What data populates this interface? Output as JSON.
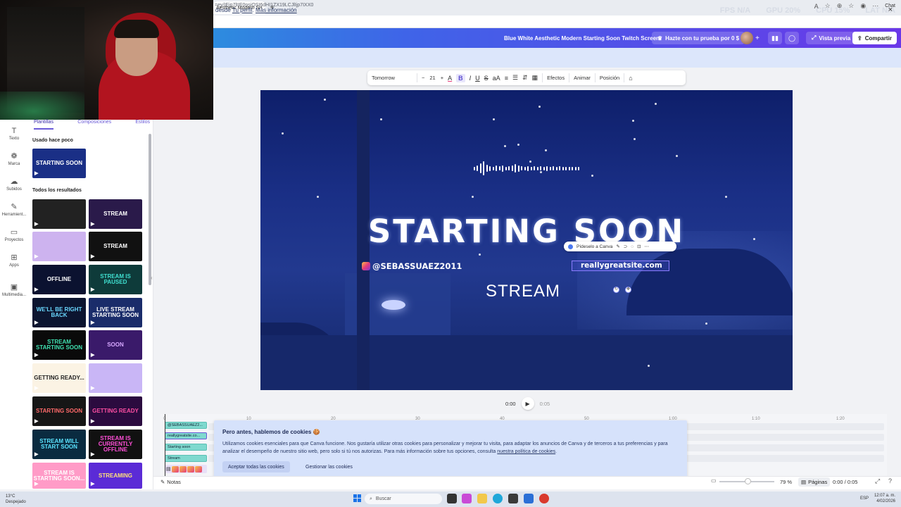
{
  "browser": {
    "tab_title": "Aesthetic Modern Star",
    "tab_close": "×",
    "new_tab": "+",
    "stats": [
      "FPS N/A",
      "GPU 20%",
      "CPU 15%",
      "LAT N/A"
    ],
    "url": "=ey/IEjp7lIIE0nsiQSI6dHI1ZX19LCJlIjp7IXX0",
    "chat_label": "Chat"
  },
  "header": {
    "doc_title": "Blue White Aesthetic Modern Starting Soon Twitch Screen",
    "trial_label": "Hazte con tu prueba por 0 $",
    "preview_label": "Vista previa",
    "share_label": "Compartir"
  },
  "banner": {
    "prefix": "desde",
    "profile_link": "Tu perfil",
    "more_link": "Más información",
    "close": "×"
  },
  "rail": [
    {
      "label": "Texto",
      "icon": "T"
    },
    {
      "label": "Marca",
      "icon": "❁"
    },
    {
      "label": "Subidos",
      "icon": "☁"
    },
    {
      "label": "Herramient...",
      "icon": "✎"
    },
    {
      "label": "Proyectos",
      "icon": "▭"
    },
    {
      "label": "Apps",
      "icon": "⊞"
    },
    {
      "label": "Multimedia...",
      "icon": "▣"
    }
  ],
  "panel": {
    "tabs": [
      "Plantillas",
      "Composiciones",
      "Estilos"
    ],
    "recent_label": "Usado hace poco",
    "all_label": "Todos los resultados",
    "recent_thumb": "STARTING SOON",
    "thumbs": [
      {
        "text": "",
        "bg": "#222",
        "fg": "#fff"
      },
      {
        "text": "STREAM",
        "bg": "#2a1a4a",
        "fg": "#fff"
      },
      {
        "text": "",
        "bg": "#cdb3ef",
        "fg": "#fff"
      },
      {
        "text": "STREAM",
        "bg": "#111",
        "fg": "#fff"
      },
      {
        "text": "OFFLINE",
        "bg": "#0b1230",
        "fg": "#fff"
      },
      {
        "text": "STREAM IS PAUSED",
        "bg": "#0e3b3a",
        "fg": "#3fe0d0"
      },
      {
        "text": "WE'LL BE RIGHT BACK",
        "bg": "#0c1530",
        "fg": "#6ad8ff"
      },
      {
        "text": "LIVE STREAM STARTING SOON",
        "bg": "#1a2c6a",
        "fg": "#fff"
      },
      {
        "text": "STREAM STARTING SOON",
        "bg": "#0a0a0a",
        "fg": "#3fe0b0"
      },
      {
        "text": "SOON",
        "bg": "#3a1a6a",
        "fg": "#d7a8ff"
      },
      {
        "text": "GETTING READY...",
        "bg": "#fbf3e4",
        "fg": "#222"
      },
      {
        "text": "",
        "bg": "#c9b6f6",
        "fg": "#fff"
      },
      {
        "text": "STARTING SOON",
        "bg": "#161616",
        "fg": "#ff6a6a"
      },
      {
        "text": "GETTING READY",
        "bg": "#2b0b3f",
        "fg": "#ff4fa3"
      },
      {
        "text": "STREAM WILL START SOON",
        "bg": "#0a2b40",
        "fg": "#5ae3ff"
      },
      {
        "text": "STREAM IS CURRENTLY OFFLINE",
        "bg": "#111",
        "fg": "#ff4fd8"
      },
      {
        "text": "STREAM IS STARTING SOON...",
        "bg": "#ff9bc7",
        "fg": "#fff"
      },
      {
        "text": "STREAMING",
        "bg": "#5b2bd6",
        "fg": "#ffe17a"
      }
    ]
  },
  "toolbar": {
    "font": "Tomorrow",
    "minus": "−",
    "size": "21",
    "plus": "+",
    "text_color_icon": "A",
    "bold": "B",
    "italic": "I",
    "underline": "U",
    "strike": "S",
    "case": "aA",
    "align": "≡",
    "list": "☰",
    "spacing": "⇵",
    "effects": "Efectos",
    "animate": "Animar",
    "position": "Posición",
    "paint": "⌂"
  },
  "canvas": {
    "heading": "STARTING SOON",
    "handle": "@SEBASSUAEZ2011",
    "site": "reallygreatsite.com",
    "stream": "STREAM",
    "ask_canva": "Pídeselo a Canva"
  },
  "playback": {
    "current": "0:00",
    "end": "0:05"
  },
  "timeline": {
    "ticks": [
      "0",
      "10",
      "20",
      "30",
      "40",
      "50",
      "1:00",
      "1:10",
      "1:20"
    ],
    "tracks": [
      "@SEBASSUAEZ2...",
      "reallygreatsite.co...",
      "Starting soon",
      "Stream"
    ]
  },
  "bottom": {
    "notes": "Notas",
    "zoom": "79 %",
    "pages": "Páginas",
    "page_time": "0:00 / 0:05"
  },
  "cookies": {
    "title": "Pero antes, hablemos de cookies 🍪",
    "body": "Utilizamos cookies esenciales para que Canva funcione. Nos gustaría utilizar otras cookies para personalizar y mejorar tu visita, para adaptar los anuncios de Canva y de terceros a tus preferencias y para analizar el desempeño de nuestro sitio web, pero solo si tú nos autorizas. Para más información sobre tus opciones, consulta",
    "policy_link": "nuestra política de cookies",
    "accept": "Aceptar todas las cookies",
    "manage": "Gestionar las cookies"
  },
  "taskbar": {
    "temp": "13°C",
    "weather": "Despejado",
    "search": "Buscar",
    "lang": "ESP",
    "time": "12:07 a. m.",
    "date": "4/02/2026"
  },
  "colors": {
    "accent": "#6a5ad8",
    "canvas_bg": "#1a2f86",
    "header_start": "#19b8d4",
    "header_end": "#6a38e8"
  }
}
